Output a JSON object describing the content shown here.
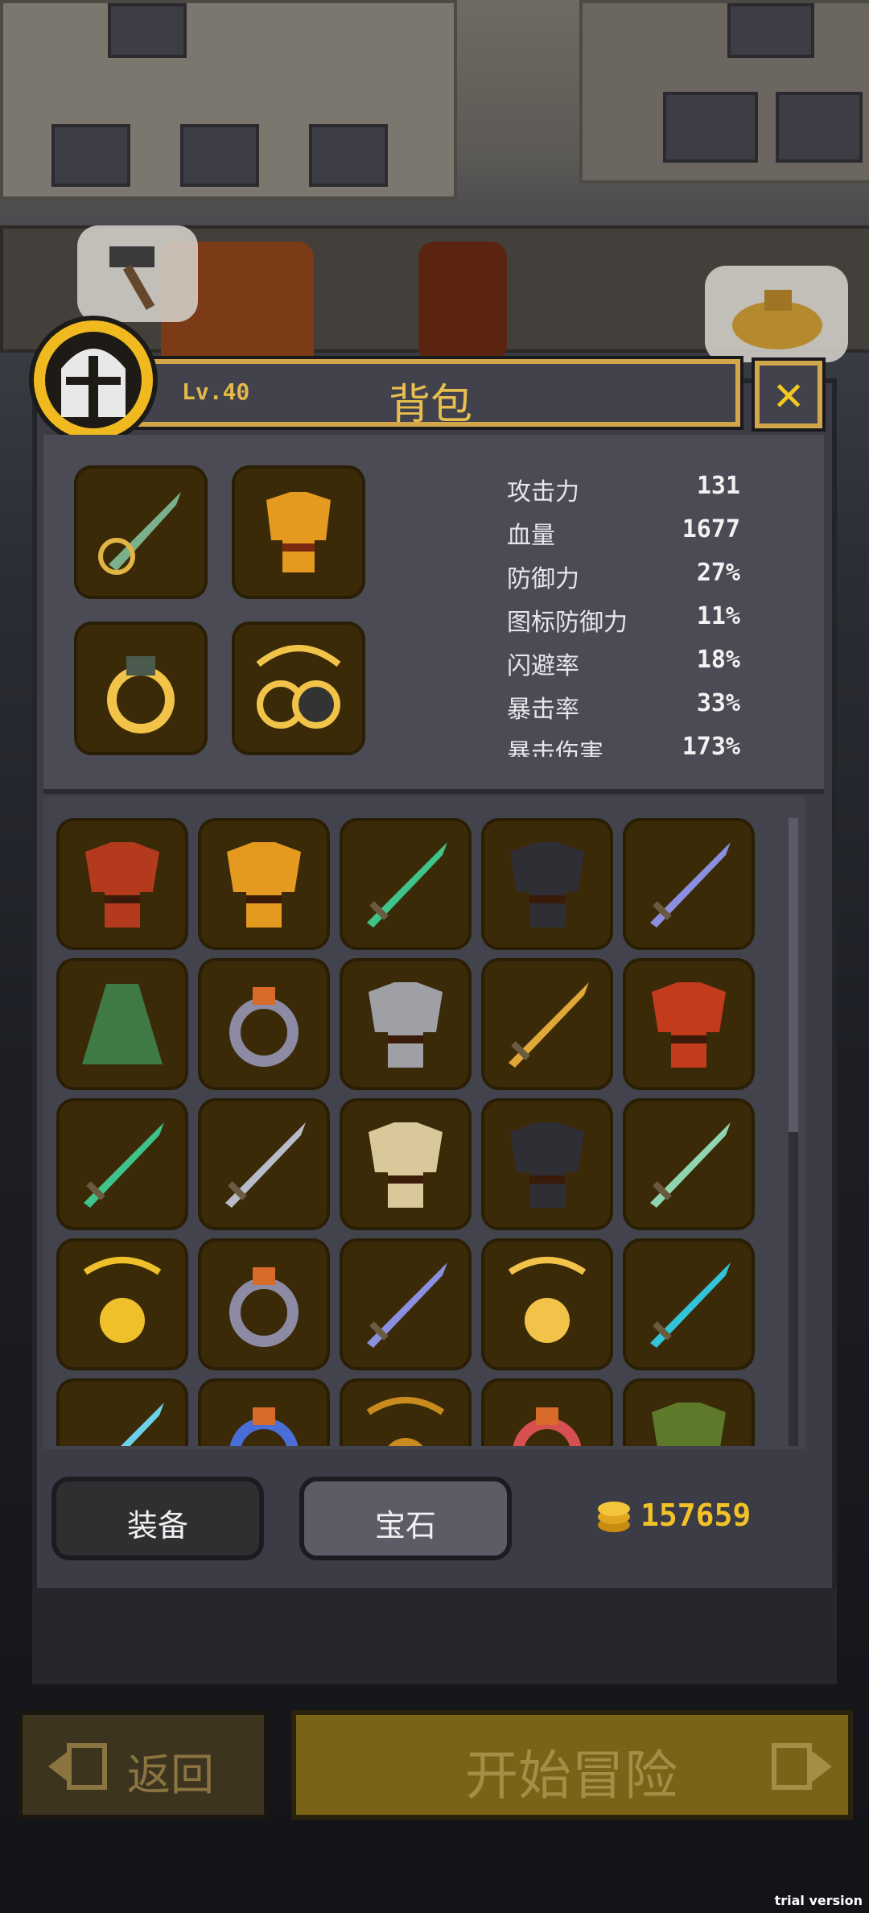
{
  "header": {
    "level": "Lv.40",
    "title": "背包",
    "close_label": "✕"
  },
  "equipped": [
    {
      "name": "weapon",
      "icon": "green-sword-icon"
    },
    {
      "name": "armor",
      "icon": "gold-armor-icon"
    },
    {
      "name": "ring",
      "icon": "gold-ring-icon"
    },
    {
      "name": "amulet",
      "icon": "gold-amulet-icon"
    }
  ],
  "stats": [
    {
      "label": "攻击力",
      "value": "131"
    },
    {
      "label": "血量",
      "value": "1677"
    },
    {
      "label": "防御力",
      "value": "27%"
    },
    {
      "label": "图标防御力",
      "value": "11%"
    },
    {
      "label": "闪避率",
      "value": "18%"
    },
    {
      "label": "暴击率",
      "value": "33%"
    },
    {
      "label": "暴击伤害",
      "value": "173%"
    }
  ],
  "inventory": [
    {
      "icon": "red-armor-icon"
    },
    {
      "icon": "gold-armor-icon"
    },
    {
      "icon": "green-sword-icon"
    },
    {
      "icon": "black-armor-icon"
    },
    {
      "icon": "blue-sword-icon"
    },
    {
      "icon": "green-cloak-icon"
    },
    {
      "icon": "silver-ring-icon"
    },
    {
      "icon": "grey-armor-icon"
    },
    {
      "icon": "gold-sword-icon"
    },
    {
      "icon": "flame-armor-icon"
    },
    {
      "icon": "green-sword-icon"
    },
    {
      "icon": "silver-sword-icon"
    },
    {
      "icon": "bone-armor-icon"
    },
    {
      "icon": "black-armor-icon"
    },
    {
      "icon": "jade-sword-icon"
    },
    {
      "icon": "star-amulet-icon"
    },
    {
      "icon": "silver-ring-icon"
    },
    {
      "icon": "blue-sword-icon"
    },
    {
      "icon": "gold-amulet-icon"
    },
    {
      "icon": "crystal-sword-icon"
    },
    {
      "icon": "ice-spear-icon"
    },
    {
      "icon": "sapphire-ring-icon"
    },
    {
      "icon": "amulet-icon"
    },
    {
      "icon": "gem-ring-icon"
    },
    {
      "icon": "green-armor-icon"
    }
  ],
  "tabs": {
    "equipment": "装备",
    "gems": "宝石"
  },
  "gold": "157659",
  "footer": {
    "back": "返回",
    "start": "开始冒险"
  },
  "watermark": "trial version",
  "colors": {
    "accent": "#d2a64a",
    "gold_text": "#f3c227",
    "slot_bg": "#3a2a08",
    "panel": "#3b3c46"
  }
}
